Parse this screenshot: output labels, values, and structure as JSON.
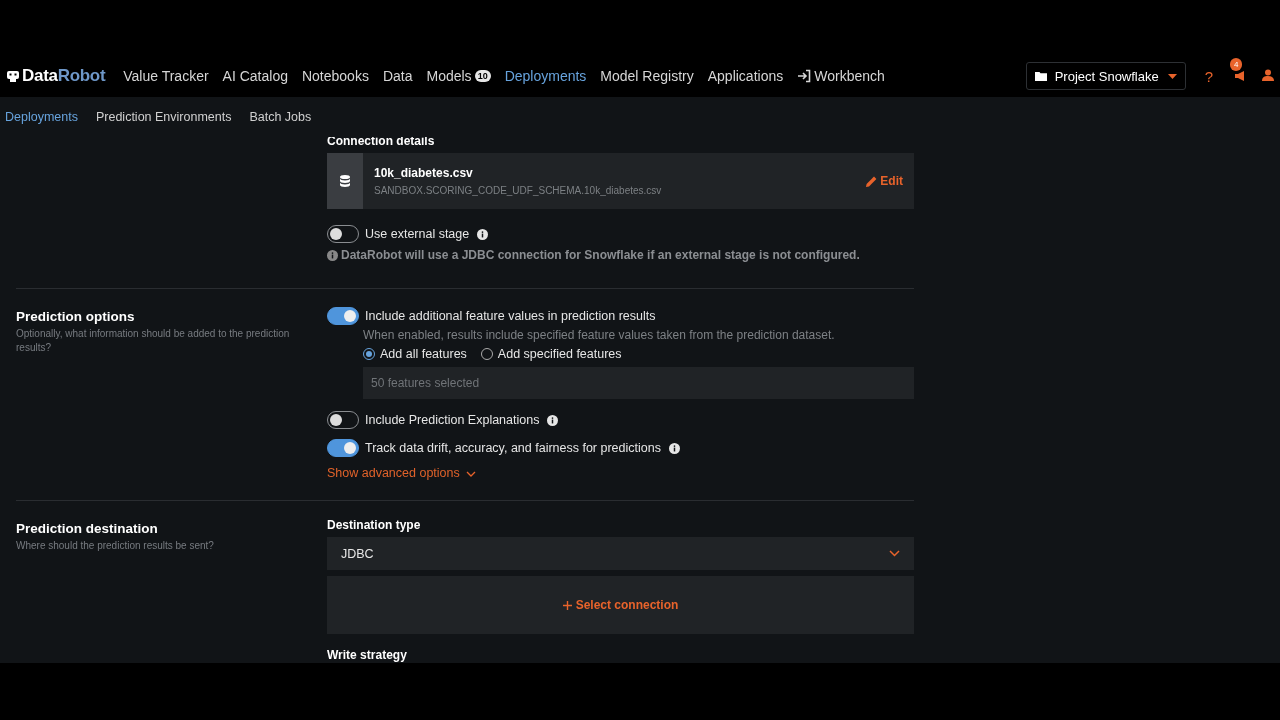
{
  "nav": {
    "logo": {
      "part_1": "Data",
      "part_2": "Robot"
    },
    "items": [
      {
        "label": "Value Tracker",
        "selected": false
      },
      {
        "label": "AI Catalog",
        "selected": false
      },
      {
        "label": "Notebooks",
        "selected": false
      },
      {
        "label": "Data",
        "selected": false
      },
      {
        "label": "Models",
        "badge": "10",
        "selected": false
      },
      {
        "label": "Deployments",
        "selected": true
      },
      {
        "label": "Model Registry",
        "selected": false
      },
      {
        "label": "Applications",
        "selected": false
      },
      {
        "label": "Workbench",
        "kind": "external",
        "selected": false
      }
    ],
    "project": "Project Snowflake",
    "help": "?",
    "notifications": "4"
  },
  "subnav": [
    {
      "label": "Deployments",
      "selected": true
    },
    {
      "label": "Prediction Environments",
      "selected": false
    },
    {
      "label": "Batch Jobs",
      "selected": false
    }
  ],
  "sections": [
    {
      "items": [
        {
          "kind": "heading",
          "text": "Connection details"
        },
        {
          "kind": "source",
          "name": "10k_diabetes.csv",
          "path": "SANDBOX.SCORING_CODE_UDF_SCHEMA.10k_diabetes.csv",
          "action": "Edit"
        },
        {
          "kind": "toggle",
          "label": "Use external stage",
          "on": false,
          "info": true
        },
        {
          "kind": "note",
          "text": "DataRobot will use a JDBC connection for Snowflake if an external stage is not configured."
        }
      ]
    },
    {
      "title": "Prediction options",
      "description": "Optionally, what information should be added to the prediction results?",
      "items": [
        {
          "kind": "toggle",
          "label": "Include additional feature values in prediction results",
          "on": true,
          "hint": "When enabled, results include specified feature values taken from the prediction dataset.",
          "radios": [
            {
              "label": "Add all features",
              "selected": true
            },
            {
              "label": "Add specified features",
              "selected": false
            }
          ],
          "field": {
            "value": "50 features selected",
            "disabled": true
          }
        },
        {
          "kind": "toggle",
          "label": "Include Prediction Explanations",
          "on": false,
          "info": true
        },
        {
          "kind": "toggle",
          "label": "Track data drift, accuracy, and fairness for predictions",
          "on": true,
          "info": true
        },
        {
          "kind": "link",
          "text": "Show advanced options",
          "expanded": false
        }
      ]
    },
    {
      "title": "Prediction destination",
      "description": "Where should the prediction results be sent?",
      "items": [
        {
          "kind": "heading",
          "text": "Destination type"
        },
        {
          "kind": "select",
          "value": "JDBC"
        },
        {
          "kind": "add",
          "text": "Select connection"
        },
        {
          "kind": "heading",
          "text": "Write strategy"
        }
      ]
    }
  ]
}
